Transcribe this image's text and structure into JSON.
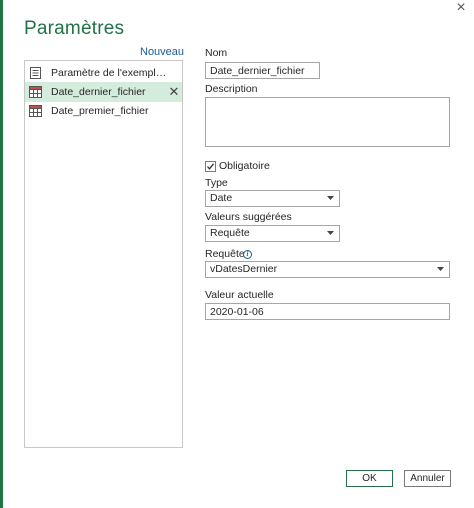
{
  "dialog": {
    "title": "Paramètres",
    "close_glyph": "×",
    "new_link": "Nouveau"
  },
  "parameters": [
    {
      "label": "Paramètre de l'exemple d...",
      "icon": "document-icon",
      "selected": false
    },
    {
      "label": "Date_dernier_fichier",
      "icon": "table-icon",
      "selected": true,
      "delete_glyph": "✕"
    },
    {
      "label": "Date_premier_fichier",
      "icon": "table-icon",
      "selected": false
    }
  ],
  "form": {
    "name_label": "Nom",
    "name_value": "Date_dernier_fichier",
    "description_label": "Description",
    "description_value": "",
    "required_label": "Obligatoire",
    "required_checked": true,
    "type_label": "Type",
    "type_value": "Date",
    "suggested_label": "Valeurs suggérées",
    "suggested_value": "Requête",
    "query_label": "Requête",
    "query_value": "vDatesDernier",
    "current_label": "Valeur actuelle",
    "current_value": "2020-01-06"
  },
  "buttons": {
    "ok": "OK",
    "cancel": "Annuler"
  },
  "colors": {
    "accent": "#217346",
    "selection": "#d3ecdc",
    "link": "#1e5a9a"
  }
}
